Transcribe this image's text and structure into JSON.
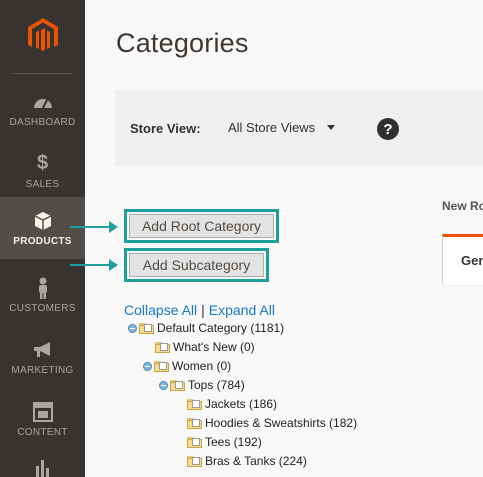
{
  "sidebar": {
    "items": [
      {
        "label": "DASHBOARD",
        "icon": "dashboard-icon"
      },
      {
        "label": "SALES",
        "icon": "dollar-icon"
      },
      {
        "label": "PRODUCTS",
        "icon": "cube-icon",
        "active": true
      },
      {
        "label": "CUSTOMERS",
        "icon": "person-icon"
      },
      {
        "label": "MARKETING",
        "icon": "megaphone-icon"
      },
      {
        "label": "CONTENT",
        "icon": "layout-icon"
      }
    ]
  },
  "page": {
    "title": "Categories"
  },
  "store_view": {
    "label": "Store View:",
    "value": "All Store Views",
    "help": "?"
  },
  "right_panel": {
    "new_root_label": "New Ro",
    "tab_label": "Gen"
  },
  "buttons": {
    "add_root": "Add Root Category",
    "add_sub": "Add Subcategory"
  },
  "tree": {
    "collapse_all": "Collapse All",
    "separator": "|",
    "expand_all": "Expand All",
    "nodes": [
      {
        "label": "Default Category (1181)"
      },
      {
        "label": "What's New (0)"
      },
      {
        "label": "Women (0)"
      },
      {
        "label": "Tops (784)"
      },
      {
        "label": "Jackets (186)"
      },
      {
        "label": "Hoodies & Sweatshirts (182)"
      },
      {
        "label": "Tees (192)"
      },
      {
        "label": "Bras & Tanks (224)"
      }
    ]
  },
  "colors": {
    "accent": "#1f9e9c",
    "sidebar": "#373330",
    "logo": "#eb5202",
    "link": "#1979c3"
  }
}
